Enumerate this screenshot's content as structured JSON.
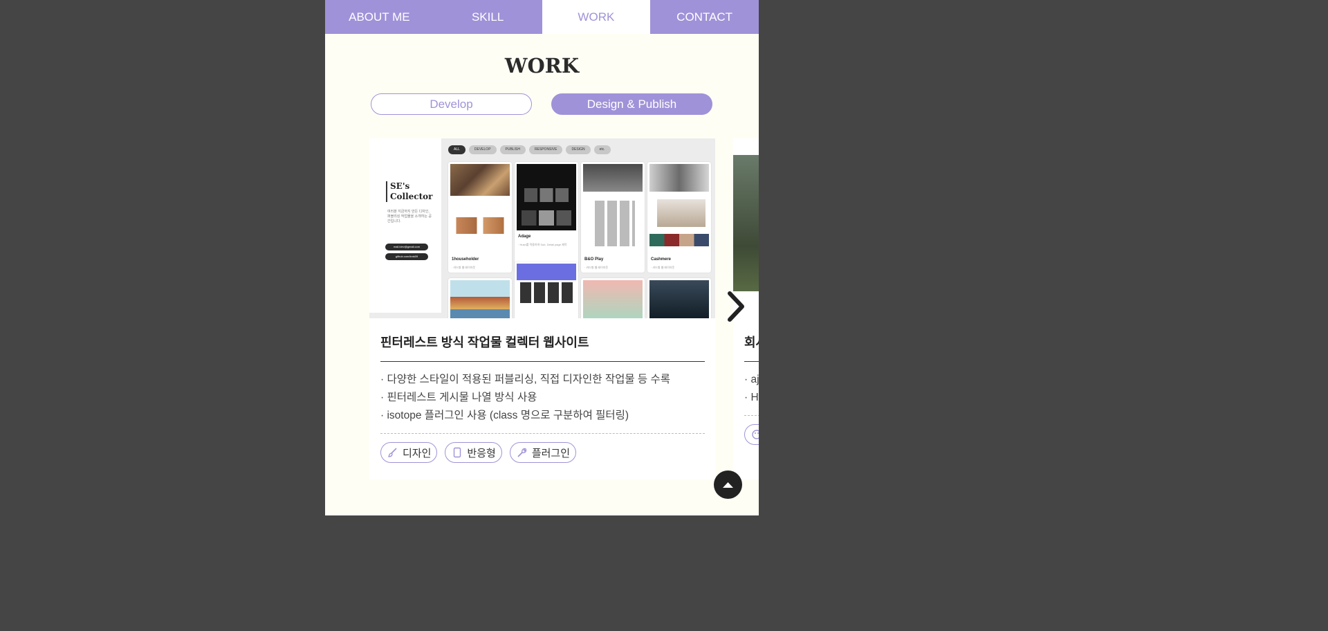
{
  "nav": {
    "tabs": [
      {
        "label": "ABOUT ME"
      },
      {
        "label": "SKILL"
      },
      {
        "label": "WORK"
      },
      {
        "label": "CONTACT"
      }
    ],
    "active": "WORK"
  },
  "section_title": "WORK",
  "filters": {
    "develop": "Develop",
    "design_publish": "Design & Publish",
    "active": "Design & Publish"
  },
  "cards": [
    {
      "thumbnail": {
        "brand": "SE's\nCollector",
        "desc": "여러분 지금까지 만든 디자인, 퍼블리싱 작업물을 소개하는 공간입니다.",
        "email": "mail.ldev@gmail.com",
        "github": "github.com/kmk09",
        "chips": [
          "ALL",
          "DEVELOP",
          "PUBLISH",
          "RESPONSIVE",
          "DESIGN",
          "etc."
        ],
        "items": [
          {
            "title": "1householder",
            "sub": "· 카드형 웹 레이아웃"
          },
          {
            "title": "Adage",
            "sub": "· Hush를 적용하여 Sub, Detail page 제작"
          },
          {
            "title": "B&O Play",
            "sub": "· 카드형 웹 레이아웃"
          },
          {
            "title": "Cashmere",
            "sub": "· 카드형 웹 레이아웃"
          }
        ]
      },
      "title": "핀터레스트 방식 작업물 컬렉터 웹사이트",
      "bullets": [
        "· 다양한 스타일이 적용된 퍼블리싱, 직접 디자인한 작업물 등 수록",
        "· 핀터레스트 게시물 나열 방식 사용",
        "· isotope 플러그인 사용 (class 명으로 구분하여 필터링)"
      ],
      "tags": [
        {
          "label": "디자인",
          "icon": "brush-icon"
        },
        {
          "label": "반응형",
          "icon": "mobile-icon"
        },
        {
          "label": "플러그인",
          "icon": "wrench-icon"
        }
      ]
    },
    {
      "title": "회사",
      "bullets": [
        "· aj",
        "· Ht"
      ],
      "tags": [
        {
          "label": "",
          "icon": "palette-icon"
        }
      ]
    }
  ],
  "colors": {
    "accent": "#a092d8",
    "page_bg": "#fffef5",
    "backdrop": "#454545"
  },
  "icons": {
    "next": "chevron-right-icon",
    "scroll_top": "arrow-up-icon"
  }
}
